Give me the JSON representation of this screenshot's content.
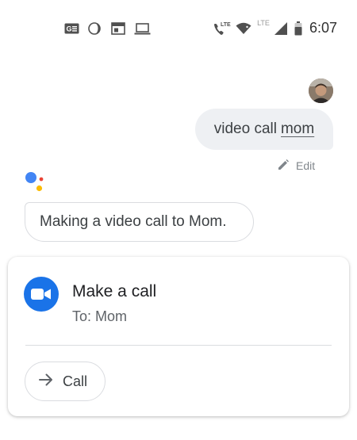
{
  "status_bar": {
    "time": "6:07",
    "left_icons": [
      "news-icon",
      "moon-icon",
      "calendar-icon",
      "laptop-icon"
    ],
    "right_icons": [
      "volte-call-icon",
      "wifi-icon",
      "cell-signal-icon",
      "battery-icon"
    ],
    "lte_labels": [
      "LTE",
      "LTE"
    ]
  },
  "conversation": {
    "user_query_words": [
      "video call",
      "mom"
    ],
    "edit_label": "Edit",
    "assistant_reply": "Making a video call to Mom."
  },
  "call_card": {
    "title": "Make a call",
    "subtitle": "To: Mom",
    "button_label": "Call",
    "app_icon": "video-camera-icon"
  },
  "colors": {
    "assistant_blue": "#4285F4",
    "assistant_red": "#EA4335",
    "assistant_yellow": "#FBBC04",
    "assistant_green": "#34A853",
    "duo_blue": "#1a73e8"
  }
}
